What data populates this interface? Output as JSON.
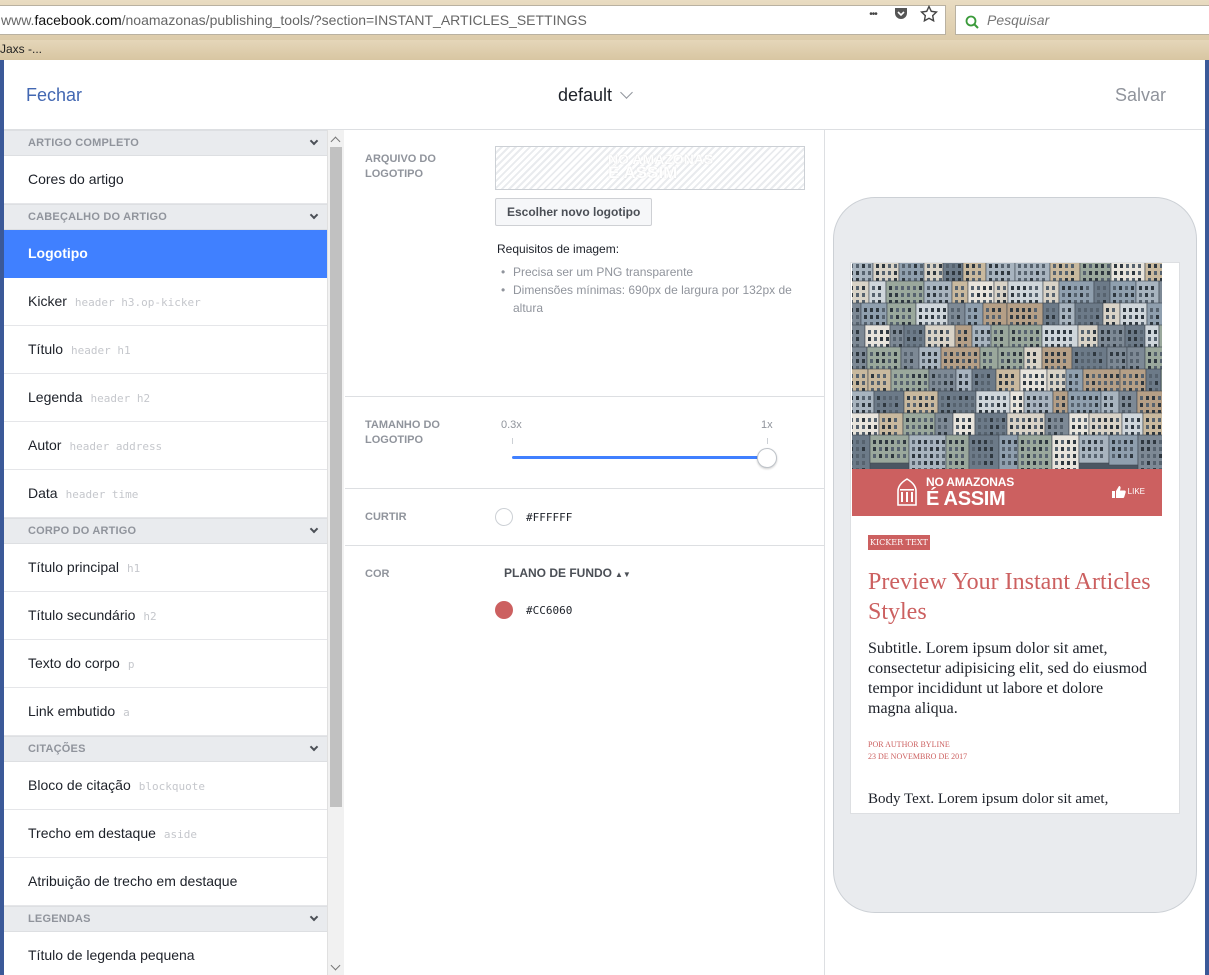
{
  "browser": {
    "url_prefix": "www.",
    "url_domain": "facebook.com",
    "url_path": "/noamazonas/publishing_tools/?section=INSTANT_ARTICLES_SETTINGS",
    "more_glyph": "•••",
    "search_placeholder": "Pesquisar",
    "bookmark": "Jaxs -..."
  },
  "topbar": {
    "close_label": "Fechar",
    "style_name": "default",
    "save_label": "Salvar"
  },
  "sidebar": {
    "sections": [
      {
        "title": "ARTIGO COMPLETO",
        "items": [
          {
            "label": "Cores do artigo",
            "hint": ""
          }
        ]
      },
      {
        "title": "CABEÇALHO DO ARTIGO",
        "items": [
          {
            "label": "Logotipo",
            "hint": "",
            "active": true
          },
          {
            "label": "Kicker",
            "hint": "header h3.op-kicker"
          },
          {
            "label": "Título",
            "hint": "header h1"
          },
          {
            "label": "Legenda",
            "hint": "header h2"
          },
          {
            "label": "Autor",
            "hint": "header address"
          },
          {
            "label": "Data",
            "hint": "header time"
          }
        ]
      },
      {
        "title": "CORPO DO ARTIGO",
        "items": [
          {
            "label": "Título principal",
            "hint": "h1"
          },
          {
            "label": "Título secundário",
            "hint": "h2"
          },
          {
            "label": "Texto do corpo",
            "hint": "p"
          },
          {
            "label": "Link embutido",
            "hint": "a"
          }
        ]
      },
      {
        "title": "CITAÇÕES",
        "items": [
          {
            "label": "Bloco de citação",
            "hint": "blockquote"
          },
          {
            "label": "Trecho em destaque",
            "hint": "aside"
          },
          {
            "label": "Atribuição de trecho em destaque",
            "hint": ""
          }
        ]
      },
      {
        "title": "LEGENDAS",
        "items": [
          {
            "label": "Título de legenda pequena",
            "hint": ""
          }
        ]
      }
    ]
  },
  "settings": {
    "logo_file_label": "ARQUIVO DO LOGOTIPO",
    "choose_logo_button": "Escolher novo logotipo",
    "requirements_title": "Requisitos de imagem:",
    "requirements": [
      "Precisa ser um PNG transparente",
      "Dimensões mínimas: 690px de largura por 132px de altura"
    ],
    "size_label": "TAMANHO DO LOGOTIPO",
    "size_min": "0.3x",
    "size_max": "1x",
    "size_value_fraction": 1.0,
    "like_label": "CURTIR",
    "like_color": "#FFFFFF",
    "color_label": "COR",
    "color_mode": "PLANO DE FUNDO",
    "background_color": "#CC6060"
  },
  "preview": {
    "logo_line1": "NO AMAZONAS",
    "logo_line2": "É ASSIM",
    "like_text": "LIKE",
    "kicker": "KICKER TEXT",
    "title": "Preview Your Instant Articles Styles",
    "subtitle": "Subtitle. Lorem ipsum dolor sit amet, consectetur adipisicing elit, sed do eiusmod tempor incididunt ut labore et dolore magna aliqua.",
    "byline": "POR AUTHOR BYLINE",
    "date": "23 DE NOVEMBRO DE 2017",
    "body": "Body Text. Lorem ipsum dolor sit amet,"
  },
  "colors": {
    "accent": "#4080ff",
    "link": "#4267b2",
    "brand_red": "#CC6060"
  }
}
